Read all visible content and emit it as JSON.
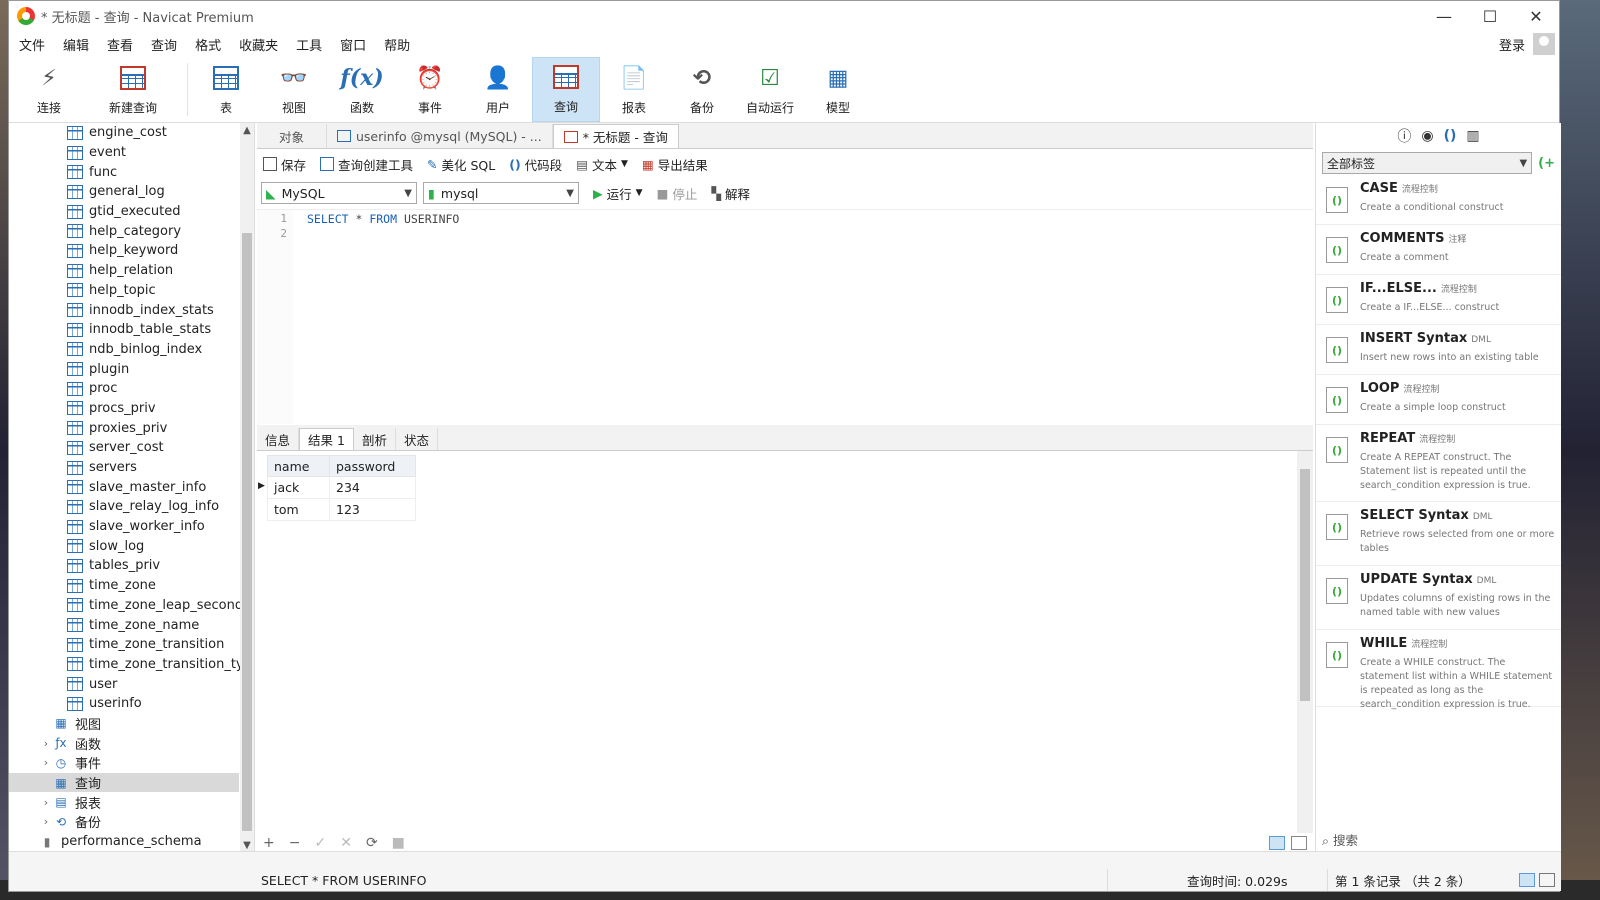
{
  "window": {
    "title": "* 无标题 - 查询 - Navicat Premium",
    "minimize": "—",
    "maximize": "☐",
    "close": "✕"
  },
  "menu": {
    "items": [
      "文件",
      "编辑",
      "查看",
      "查询",
      "格式",
      "收藏夹",
      "工具",
      "窗口",
      "帮助"
    ],
    "login": "登录"
  },
  "toolbar": {
    "items": [
      {
        "label": "连接",
        "icon": "plug-icon"
      },
      {
        "label": "新建查询",
        "icon": "new-query-icon"
      },
      {
        "label": "表",
        "icon": "table-icon"
      },
      {
        "label": "视图",
        "icon": "view-icon"
      },
      {
        "label": "函数",
        "icon": "function-icon"
      },
      {
        "label": "事件",
        "icon": "clock-icon"
      },
      {
        "label": "用户",
        "icon": "user-icon"
      },
      {
        "label": "查询",
        "icon": "query-icon"
      },
      {
        "label": "报表",
        "icon": "report-icon"
      },
      {
        "label": "备份",
        "icon": "backup-icon"
      },
      {
        "label": "自动运行",
        "icon": "schedule-icon"
      },
      {
        "label": "模型",
        "icon": "model-icon"
      }
    ]
  },
  "sidebar": {
    "tables": [
      "engine_cost",
      "event",
      "func",
      "general_log",
      "gtid_executed",
      "help_category",
      "help_keyword",
      "help_relation",
      "help_topic",
      "innodb_index_stats",
      "innodb_table_stats",
      "ndb_binlog_index",
      "plugin",
      "proc",
      "procs_priv",
      "proxies_priv",
      "server_cost",
      "servers",
      "slave_master_info",
      "slave_relay_log_info",
      "slave_worker_info",
      "slow_log",
      "tables_priv",
      "time_zone",
      "time_zone_leap_second",
      "time_zone_name",
      "time_zone_transition",
      "time_zone_transition_type",
      "user",
      "userinfo"
    ],
    "groups": {
      "views": "视图",
      "functions": "函数",
      "events": "事件",
      "queries": "查询",
      "reports": "报表",
      "backups": "备份"
    },
    "schema": "performance_schema"
  },
  "tabs": {
    "objects": "对象",
    "userinfo": "userinfo @mysql (MySQL) - ...",
    "query": "* 无标题 - 查询"
  },
  "query_toolbar": {
    "save": "保存",
    "builder": "查询创建工具",
    "beautify": "美化 SQL",
    "snippet": "代码段",
    "text": "文本",
    "export": "导出结果"
  },
  "query_toolbar2": {
    "connection": "MySQL",
    "database": "mysql",
    "run": "运行",
    "stop": "停止",
    "explain": "解释"
  },
  "editor": {
    "line_numbers": [
      "1",
      "2"
    ],
    "line1": {
      "kw1": "SELECT",
      "star": " * ",
      "kw2": "FROM",
      "table": " USERINFO"
    }
  },
  "result_tabs": [
    "信息",
    "结果 1",
    "剖析",
    "状态"
  ],
  "results": {
    "columns": [
      "name",
      "password"
    ],
    "rows": [
      [
        "jack",
        "234"
      ],
      [
        "tom",
        "123"
      ]
    ]
  },
  "result_bottom": {
    "add": "+",
    "remove": "−",
    "apply": "✓",
    "discard": "✕",
    "refresh": "⟳",
    "stop": "■"
  },
  "right_panel": {
    "filter": "全部标签",
    "snippets": [
      {
        "title": "CASE",
        "tag": "流程控制",
        "desc": "Create a conditional construct"
      },
      {
        "title": "COMMENTS",
        "tag": "注释",
        "desc": "Create a comment"
      },
      {
        "title": "IF...ELSE...",
        "tag": "流程控制",
        "desc": "Create a IF...ELSE... construct"
      },
      {
        "title": "INSERT Syntax",
        "tag": "DML",
        "desc": "Insert new rows into an existing table"
      },
      {
        "title": "LOOP",
        "tag": "流程控制",
        "desc": "Create a simple loop construct"
      },
      {
        "title": "REPEAT",
        "tag": "流程控制",
        "desc": "Create A REPEAT construct. The Statement list is repeated until the search_condition expression is true."
      },
      {
        "title": "SELECT Syntax",
        "tag": "DML",
        "desc": "Retrieve rows selected from one or more tables"
      },
      {
        "title": "UPDATE Syntax",
        "tag": "DML",
        "desc": "Updates columns of existing rows in the named table with new values"
      },
      {
        "title": "WHILE",
        "tag": "流程控制",
        "desc": "Create a WHILE construct. The statement list within a WHILE statement is repeated as long as the search_condition expression is true."
      }
    ],
    "search": "搜索"
  },
  "status": {
    "sql": "SELECT * FROM USERINFO",
    "time": "查询时间: 0.029s",
    "records": "第 1 条记录 （共 2 条）"
  },
  "colors": {
    "accent": "#2a6fb5",
    "active_tab": "#cde4f7",
    "run_green": "#2bb24c"
  }
}
